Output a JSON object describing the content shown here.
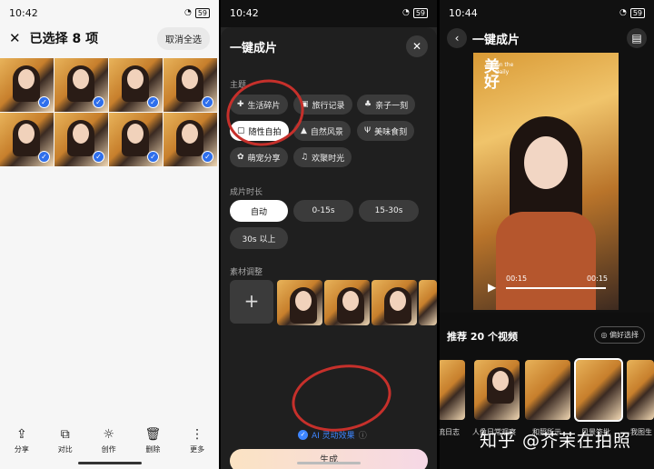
{
  "screen1": {
    "status_time": "10:42",
    "battery": "59",
    "title": "已选择 8 项",
    "deselect_all": "取消全选",
    "bottom_actions": [
      {
        "label": "分享",
        "icon": "share-icon"
      },
      {
        "label": "对比",
        "icon": "compare-icon"
      },
      {
        "label": "创作",
        "icon": "bulb-icon"
      },
      {
        "label": "删除",
        "icon": "trash-icon"
      },
      {
        "label": "更多",
        "icon": "more-icon"
      }
    ]
  },
  "screen2": {
    "status_time": "10:42",
    "battery": "59",
    "sheet_title": "一键成片",
    "theme_label": "主题",
    "themes": [
      "生活碎片",
      "旅行记录",
      "亲子一刻",
      "随性自拍",
      "自然风景",
      "美味食刻",
      "萌宠分享",
      "欢聚时光"
    ],
    "selected_theme": "随性自拍",
    "duration_label": "成片时长",
    "durations": [
      "自动",
      "0-15s",
      "15-30s",
      "30s 以上"
    ],
    "selected_duration": "自动",
    "material_label": "素材调整",
    "ai_effect": "AI 灵动效果",
    "generate": "生成",
    "highlight_color": "#c6302b"
  },
  "screen3": {
    "status_time": "10:44",
    "battery": "59",
    "title": "一键成片",
    "poster_title": "美好",
    "poster_sub1": "On the",
    "poster_sub2": "Daily",
    "time_left": "00:15",
    "time_right": "00:15",
    "recommend": "推荐 20 个视频",
    "preference": "偏好选择",
    "cards": [
      "流日志",
      "人像日常观察",
      "和照所示",
      "风景签批",
      "我图生"
    ],
    "watermark": "知乎 @芥茉在拍照"
  }
}
